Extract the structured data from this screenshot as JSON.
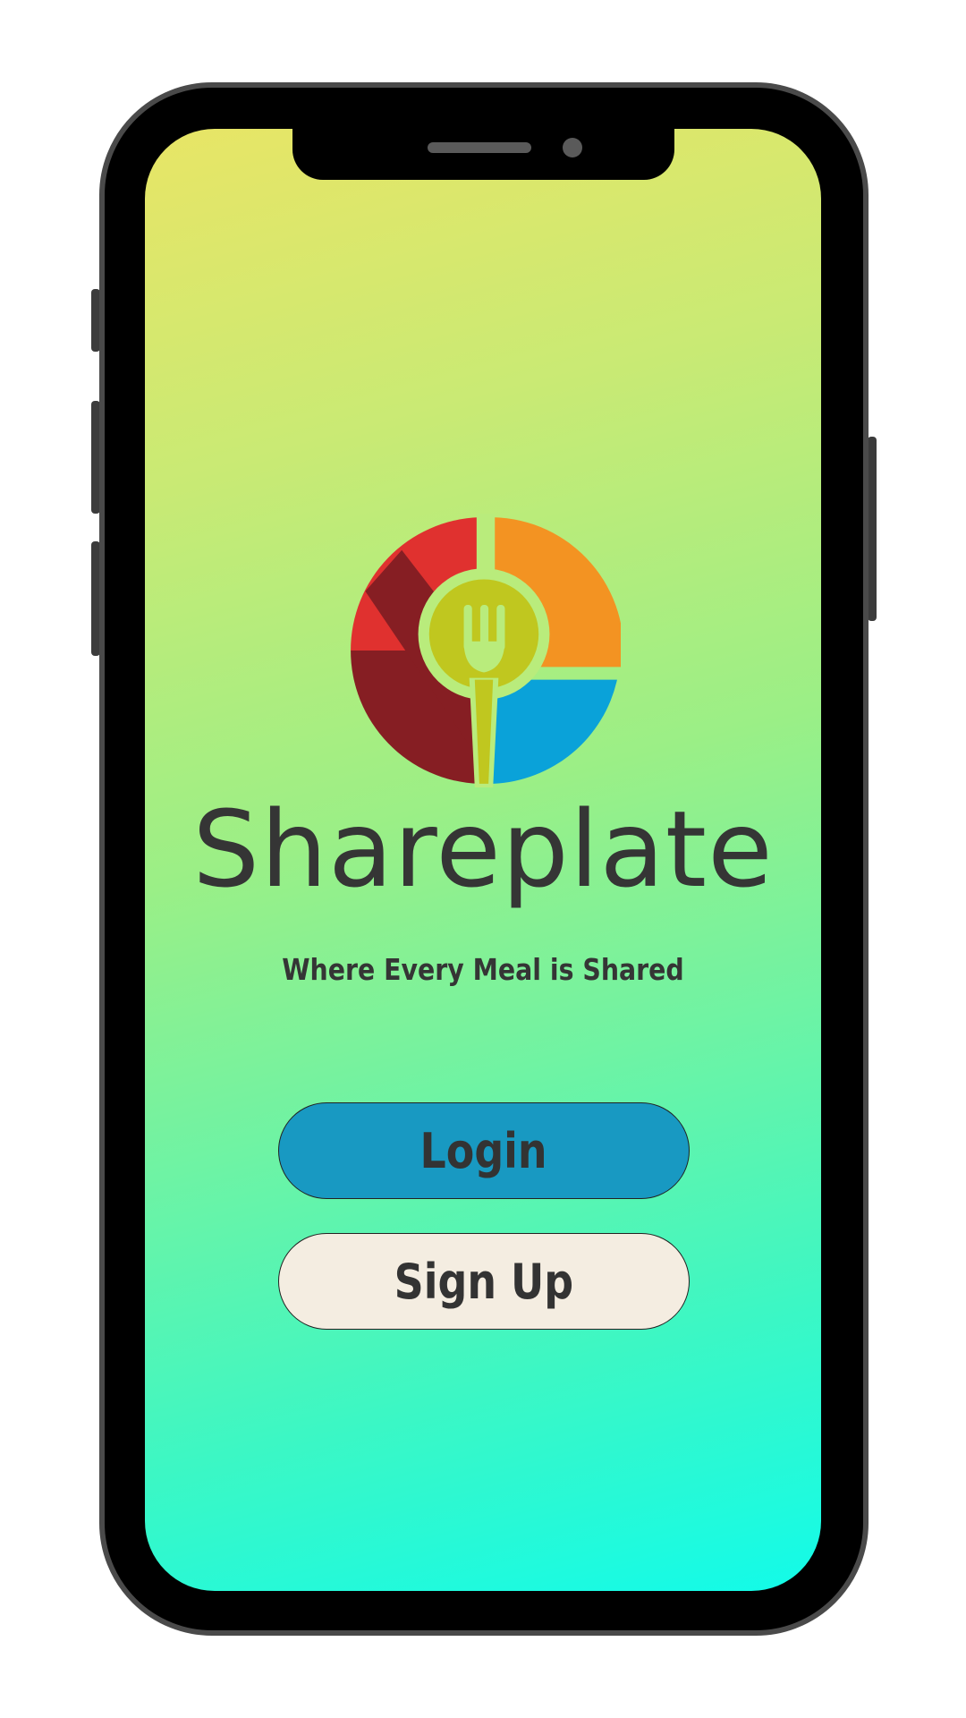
{
  "app": {
    "brand_name": "Shareplate",
    "tagline": "Where Every Meal is Shared"
  },
  "actions": {
    "login_label": "Login",
    "signup_label": "Sign Up"
  },
  "icons": {
    "logo": "plate-with-spoon-fork-icon"
  },
  "colors": {
    "gradient_top": "#e8e566",
    "gradient_bottom": "#12fbe9",
    "login_button": "#1899c2",
    "signup_button": "#f4ede1",
    "text_dark": "#353535",
    "logo_red": "#e0312f",
    "logo_dark_red": "#861e23",
    "logo_orange": "#f39322",
    "logo_blue": "#0aa2d9",
    "logo_olive": "#c0c71f"
  }
}
